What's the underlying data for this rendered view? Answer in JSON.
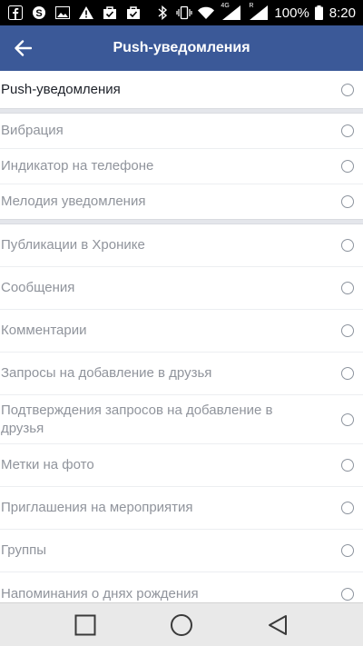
{
  "status_bar": {
    "left_icons": [
      "facebook-icon",
      "skype-icon",
      "image-icon",
      "warning-icon",
      "bag-icon",
      "check-bag-icon"
    ],
    "battery": "100%",
    "time": "8:20",
    "network_label_1": "4G",
    "network_label_2": "R"
  },
  "app_bar": {
    "title": "Push-уведомления",
    "back_icon": "arrow-left-icon"
  },
  "sections": [
    {
      "items": [
        {
          "label": "Push-уведомления",
          "primary": true,
          "selected": false
        }
      ]
    },
    {
      "items": [
        {
          "label": "Вибрация",
          "primary": false,
          "selected": false
        },
        {
          "label": "Индикатор на телефоне",
          "primary": false,
          "selected": false
        },
        {
          "label": "Мелодия уведомления",
          "primary": false,
          "selected": false
        }
      ]
    },
    {
      "items": [
        {
          "label": "Публикации в Хронике",
          "primary": false,
          "selected": false
        },
        {
          "label": "Сообщения",
          "primary": false,
          "selected": false
        },
        {
          "label": "Комментарии",
          "primary": false,
          "selected": false
        },
        {
          "label": "Запросы на добавление в друзья",
          "primary": false,
          "selected": false
        },
        {
          "label": "Подтверждения запросов на добавление в друзья",
          "primary": false,
          "selected": false
        },
        {
          "label": "Метки на фото",
          "primary": false,
          "selected": false
        },
        {
          "label": "Приглашения на мероприятия",
          "primary": false,
          "selected": false
        },
        {
          "label": "Группы",
          "primary": false,
          "selected": false
        },
        {
          "label": "Напоминания о днях рождения",
          "primary": false,
          "selected": false
        }
      ]
    }
  ],
  "nav_bar": {
    "buttons": [
      "recents-square-icon",
      "home-circle-icon",
      "back-triangle-icon"
    ]
  },
  "colors": {
    "app_bar": "#3b5998",
    "text_primary": "#1d2129",
    "text_secondary": "#90949c"
  }
}
